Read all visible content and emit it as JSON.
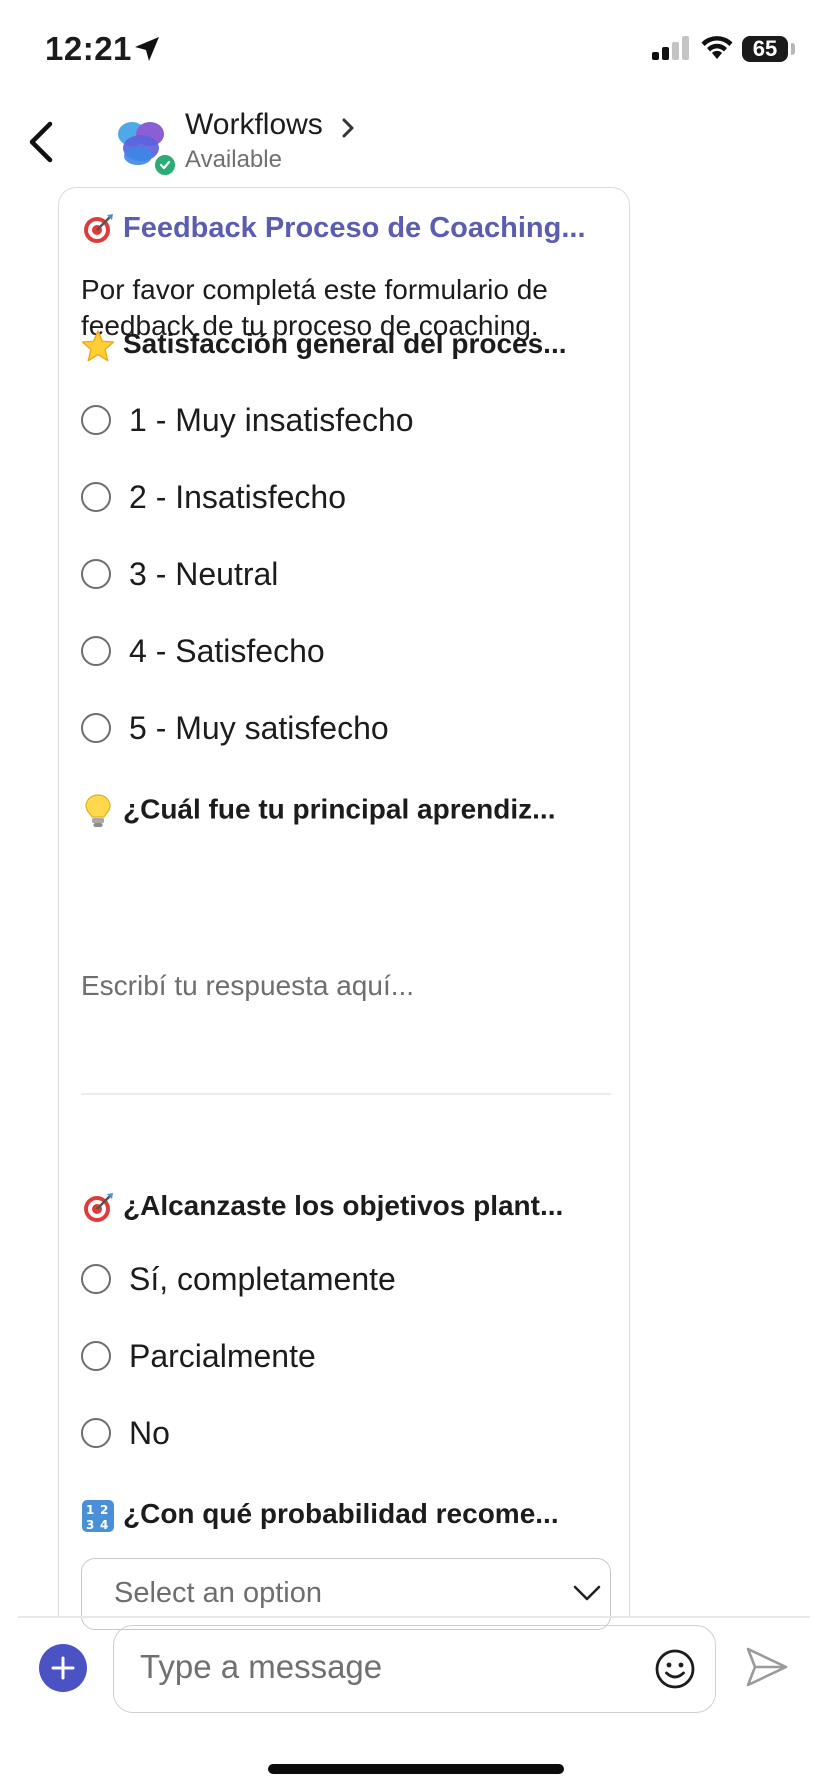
{
  "status_bar": {
    "time": "12:21",
    "battery": "65"
  },
  "header": {
    "title": "Workflows",
    "status": "Available"
  },
  "form": {
    "title": "Feedback Proceso de Coaching...",
    "description": "Por favor completá este formulario de feedback de tu proceso de coaching.",
    "q1": {
      "title": "Satisfacción general del proces...",
      "options": [
        "1 - Muy insatisfecho",
        "2 - Insatisfecho",
        "3 - Neutral",
        "4 - Satisfecho",
        "5 - Muy satisfecho"
      ]
    },
    "q2": {
      "title": "¿Cuál fue tu principal aprendiz...",
      "placeholder": "Escribí tu respuesta aquí..."
    },
    "q3": {
      "title": "¿Alcanzaste los objetivos plant...",
      "options": [
        "Sí, completamente",
        "Parcialmente",
        "No"
      ]
    },
    "q4": {
      "title": "¿Con qué probabilidad recome...",
      "select_placeholder": "Select an option"
    }
  },
  "composer": {
    "placeholder": "Type a message"
  },
  "icons": {
    "form_title": "target-icon",
    "q1": "star-icon",
    "q2": "light-bulb-icon",
    "q3": "target-icon",
    "q4": "numbers-icon"
  },
  "colors": {
    "accent": "#4a52c4",
    "form_title": "#5a5db0",
    "presence": "#2bac76"
  }
}
